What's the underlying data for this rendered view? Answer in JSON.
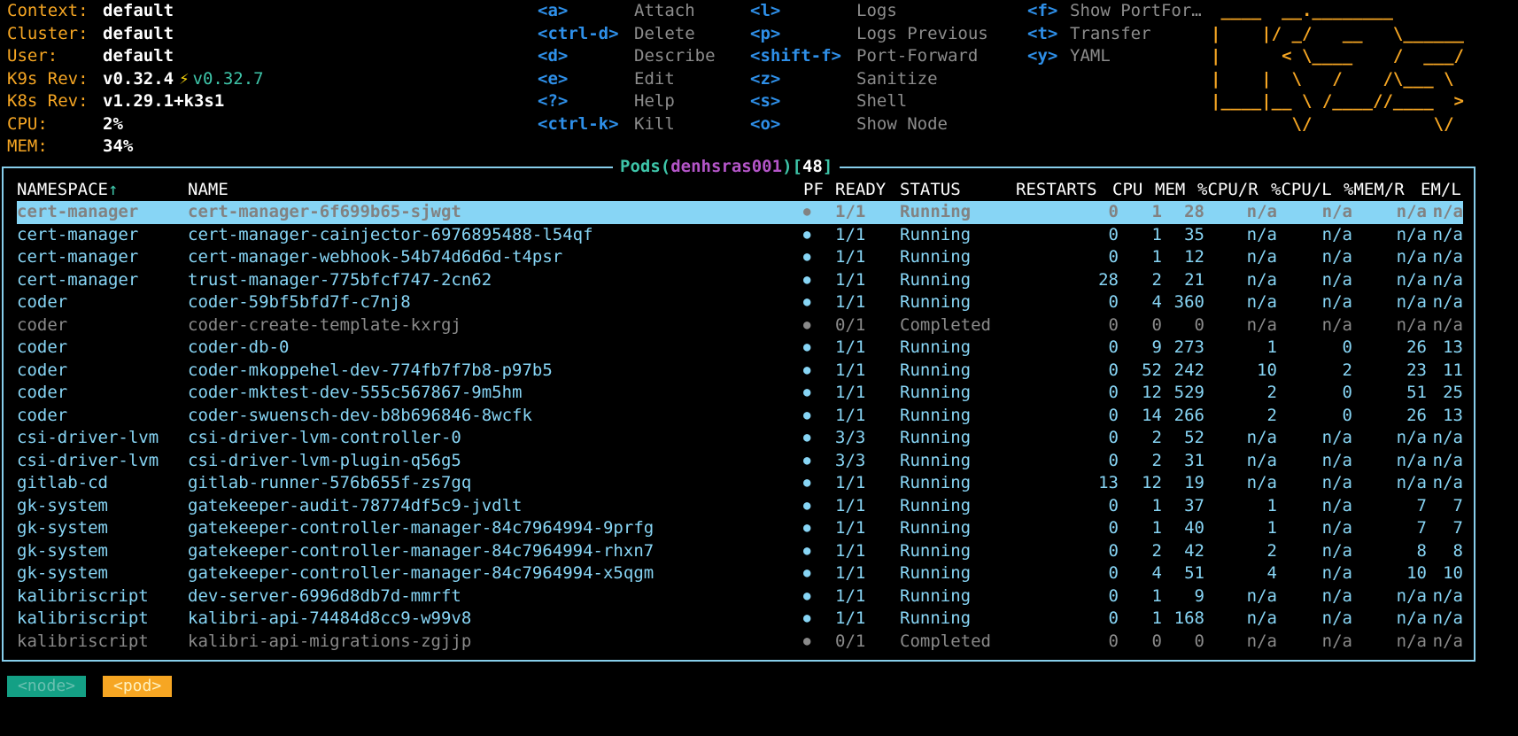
{
  "header": {
    "info": [
      {
        "label": "Context:",
        "value": "default"
      },
      {
        "label": "Cluster:",
        "value": "default"
      },
      {
        "label": "User:",
        "value": "default"
      },
      {
        "label": "K9s Rev:",
        "value": "v0.32.4",
        "update_icon": "⚡",
        "update_version": "v0.32.7"
      },
      {
        "label": "K8s Rev:",
        "value": "v1.29.1+k3s1"
      },
      {
        "label": "CPU:",
        "value": "2%"
      },
      {
        "label": "MEM:",
        "value": "34%"
      }
    ],
    "shortcuts": {
      "col1": [
        {
          "key": "<a>",
          "desc": "Attach"
        },
        {
          "key": "<ctrl-d>",
          "desc": "Delete"
        },
        {
          "key": "<d>",
          "desc": "Describe"
        },
        {
          "key": "<e>",
          "desc": "Edit"
        },
        {
          "key": "<?>",
          "desc": "Help"
        },
        {
          "key": "<ctrl-k>",
          "desc": "Kill"
        }
      ],
      "col2": [
        {
          "key": "<l>",
          "desc": "Logs"
        },
        {
          "key": "<p>",
          "desc": "Logs Previous"
        },
        {
          "key": "<shift-f>",
          "desc": "Port-Forward"
        },
        {
          "key": "<z>",
          "desc": "Sanitize"
        },
        {
          "key": "<s>",
          "desc": "Shell"
        },
        {
          "key": "<o>",
          "desc": "Show Node"
        }
      ],
      "col3": [
        {
          "key": "<f>",
          "desc": "Show PortFor…"
        },
        {
          "key": "<t>",
          "desc": "Transfer"
        },
        {
          "key": "<y>",
          "desc": "YAML"
        }
      ]
    },
    "logo_lines": [
      " ____  __.________",
      "|    |/ _/   __   \\______",
      "|      < \\____    /  ___/",
      "|    |  \\   /    /\\___ \\",
      "|____|__ \\ /____//____  >",
      "        \\/            \\/"
    ]
  },
  "table": {
    "title_word": "Pods",
    "title_context": "denhsras001",
    "title_count": "48",
    "headers": {
      "namespace": "NAMESPACE",
      "sort_arrow": "↑",
      "name": "NAME",
      "pf": "PF",
      "ready": "READY",
      "status": "STATUS",
      "restarts": "RESTARTS",
      "cpu": "CPU",
      "mem": "MEM",
      "cpu_r": "%CPU/R",
      "cpu_l": "%CPU/L",
      "mem_r": "%MEM/R",
      "mem_l": "EM/L"
    },
    "rows": [
      {
        "ns": "cert-manager",
        "name": "cert-manager-6f699b65-sjwgt",
        "pf": "●",
        "ready": "1/1",
        "status": "Running",
        "restarts": "0",
        "cpu": "1",
        "mem": "28",
        "cpu_r": "n/a",
        "cpu_l": "n/a",
        "mem_r": "n/a",
        "mem_l": "n/a",
        "selected": true
      },
      {
        "ns": "cert-manager",
        "name": "cert-manager-cainjector-6976895488-l54qf",
        "pf": "●",
        "ready": "1/1",
        "status": "Running",
        "restarts": "0",
        "cpu": "1",
        "mem": "35",
        "cpu_r": "n/a",
        "cpu_l": "n/a",
        "mem_r": "n/a",
        "mem_l": "n/a"
      },
      {
        "ns": "cert-manager",
        "name": "cert-manager-webhook-54b74d6d6d-t4psr",
        "pf": "●",
        "ready": "1/1",
        "status": "Running",
        "restarts": "0",
        "cpu": "1",
        "mem": "12",
        "cpu_r": "n/a",
        "cpu_l": "n/a",
        "mem_r": "n/a",
        "mem_l": "n/a"
      },
      {
        "ns": "cert-manager",
        "name": "trust-manager-775bfcf747-2cn62",
        "pf": "●",
        "ready": "1/1",
        "status": "Running",
        "restarts": "28",
        "cpu": "2",
        "mem": "21",
        "cpu_r": "n/a",
        "cpu_l": "n/a",
        "mem_r": "n/a",
        "mem_l": "n/a"
      },
      {
        "ns": "coder",
        "name": "coder-59bf5bfd7f-c7nj8",
        "pf": "●",
        "ready": "1/1",
        "status": "Running",
        "restarts": "0",
        "cpu": "4",
        "mem": "360",
        "cpu_r": "n/a",
        "cpu_l": "n/a",
        "mem_r": "n/a",
        "mem_l": "n/a"
      },
      {
        "ns": "coder",
        "name": "coder-create-template-kxrgj",
        "pf": "●",
        "ready": "0/1",
        "status": "Completed",
        "restarts": "0",
        "cpu": "0",
        "mem": "0",
        "cpu_r": "n/a",
        "cpu_l": "n/a",
        "mem_r": "n/a",
        "mem_l": "n/a",
        "completed": true
      },
      {
        "ns": "coder",
        "name": "coder-db-0",
        "pf": "●",
        "ready": "1/1",
        "status": "Running",
        "restarts": "0",
        "cpu": "9",
        "mem": "273",
        "cpu_r": "1",
        "cpu_l": "0",
        "mem_r": "26",
        "mem_l": "13"
      },
      {
        "ns": "coder",
        "name": "coder-mkoppehel-dev-774fb7f7b8-p97b5",
        "pf": "●",
        "ready": "1/1",
        "status": "Running",
        "restarts": "0",
        "cpu": "52",
        "mem": "242",
        "cpu_r": "10",
        "cpu_l": "2",
        "mem_r": "23",
        "mem_l": "11"
      },
      {
        "ns": "coder",
        "name": "coder-mktest-dev-555c567867-9m5hm",
        "pf": "●",
        "ready": "1/1",
        "status": "Running",
        "restarts": "0",
        "cpu": "12",
        "mem": "529",
        "cpu_r": "2",
        "cpu_l": "0",
        "mem_r": "51",
        "mem_l": "25"
      },
      {
        "ns": "coder",
        "name": "coder-swuensch-dev-b8b696846-8wcfk",
        "pf": "●",
        "ready": "1/1",
        "status": "Running",
        "restarts": "0",
        "cpu": "14",
        "mem": "266",
        "cpu_r": "2",
        "cpu_l": "0",
        "mem_r": "26",
        "mem_l": "13"
      },
      {
        "ns": "csi-driver-lvm",
        "name": "csi-driver-lvm-controller-0",
        "pf": "●",
        "ready": "3/3",
        "status": "Running",
        "restarts": "0",
        "cpu": "2",
        "mem": "52",
        "cpu_r": "n/a",
        "cpu_l": "n/a",
        "mem_r": "n/a",
        "mem_l": "n/a"
      },
      {
        "ns": "csi-driver-lvm",
        "name": "csi-driver-lvm-plugin-q56g5",
        "pf": "●",
        "ready": "3/3",
        "status": "Running",
        "restarts": "0",
        "cpu": "2",
        "mem": "31",
        "cpu_r": "n/a",
        "cpu_l": "n/a",
        "mem_r": "n/a",
        "mem_l": "n/a"
      },
      {
        "ns": "gitlab-cd",
        "name": "gitlab-runner-576b655f-zs7gq",
        "pf": "●",
        "ready": "1/1",
        "status": "Running",
        "restarts": "13",
        "cpu": "12",
        "mem": "19",
        "cpu_r": "n/a",
        "cpu_l": "n/a",
        "mem_r": "n/a",
        "mem_l": "n/a"
      },
      {
        "ns": "gk-system",
        "name": "gatekeeper-audit-78774df5c9-jvdlt",
        "pf": "●",
        "ready": "1/1",
        "status": "Running",
        "restarts": "0",
        "cpu": "1",
        "mem": "37",
        "cpu_r": "1",
        "cpu_l": "n/a",
        "mem_r": "7",
        "mem_l": "7"
      },
      {
        "ns": "gk-system",
        "name": "gatekeeper-controller-manager-84c7964994-9prfg",
        "pf": "●",
        "ready": "1/1",
        "status": "Running",
        "restarts": "0",
        "cpu": "1",
        "mem": "40",
        "cpu_r": "1",
        "cpu_l": "n/a",
        "mem_r": "7",
        "mem_l": "7"
      },
      {
        "ns": "gk-system",
        "name": "gatekeeper-controller-manager-84c7964994-rhxn7",
        "pf": "●",
        "ready": "1/1",
        "status": "Running",
        "restarts": "0",
        "cpu": "2",
        "mem": "42",
        "cpu_r": "2",
        "cpu_l": "n/a",
        "mem_r": "8",
        "mem_l": "8"
      },
      {
        "ns": "gk-system",
        "name": "gatekeeper-controller-manager-84c7964994-x5qgm",
        "pf": "●",
        "ready": "1/1",
        "status": "Running",
        "restarts": "0",
        "cpu": "4",
        "mem": "51",
        "cpu_r": "4",
        "cpu_l": "n/a",
        "mem_r": "10",
        "mem_l": "10"
      },
      {
        "ns": "kalibriscript",
        "name": "dev-server-6996d8db7d-mmrft",
        "pf": "●",
        "ready": "1/1",
        "status": "Running",
        "restarts": "0",
        "cpu": "1",
        "mem": "9",
        "cpu_r": "n/a",
        "cpu_l": "n/a",
        "mem_r": "n/a",
        "mem_l": "n/a"
      },
      {
        "ns": "kalibriscript",
        "name": "kalibri-api-74484d8cc9-w99v8",
        "pf": "●",
        "ready": "1/1",
        "status": "Running",
        "restarts": "0",
        "cpu": "1",
        "mem": "168",
        "cpu_r": "n/a",
        "cpu_l": "n/a",
        "mem_r": "n/a",
        "mem_l": "n/a"
      },
      {
        "ns": "kalibriscript",
        "name": "kalibri-api-migrations-zgjjp",
        "pf": "●",
        "ready": "0/1",
        "status": "Completed",
        "restarts": "0",
        "cpu": "0",
        "mem": "0",
        "cpu_r": "n/a",
        "cpu_l": "n/a",
        "mem_r": "n/a",
        "mem_l": "n/a",
        "completed": true
      }
    ]
  },
  "crumbs": {
    "node": "<node>",
    "pod": "<pod>"
  },
  "colors": {
    "accent_orange": "#f6a623",
    "key_blue": "#2e8fe8",
    "row_cyan": "#87d5f5",
    "frame_border": "#87ceeb",
    "title_green": "#3ec5a9",
    "context_purple": "#b455c8",
    "completed_gray": "#8a8a8a"
  }
}
